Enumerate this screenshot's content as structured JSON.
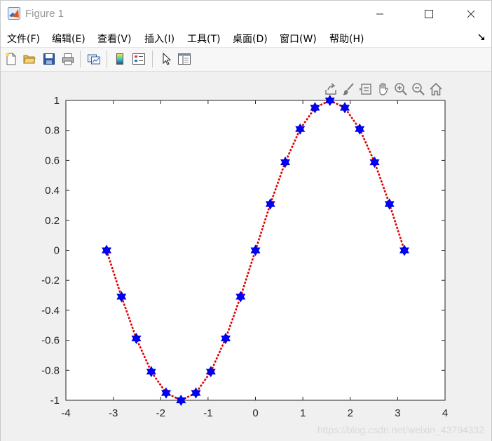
{
  "window": {
    "title": "Figure 1",
    "controls": [
      "minimize",
      "maximize",
      "close"
    ]
  },
  "menubar": {
    "items": [
      "文件(F)",
      "编辑(E)",
      "查看(V)",
      "插入(I)",
      "工具(T)",
      "桌面(D)",
      "窗口(W)",
      "帮助(H)"
    ]
  },
  "toolbar": {
    "buttons": [
      "new-figure",
      "open-file",
      "save",
      "print",
      "link-plot",
      "insert-colorbar",
      "insert-legend",
      "edit-plot",
      "property-inspector"
    ]
  },
  "axes_toolbar": {
    "buttons": [
      "export-icon",
      "brush-icon",
      "data-tips-icon",
      "pan-icon",
      "zoom-in-icon",
      "zoom-out-icon",
      "home-icon"
    ]
  },
  "chart_data": {
    "type": "line",
    "xlim": [
      -4,
      4
    ],
    "ylim": [
      -1,
      1
    ],
    "xticks": [
      "-4",
      "-3",
      "-2",
      "-1",
      "0",
      "1",
      "2",
      "3",
      "4"
    ],
    "yticks": [
      "1",
      "0.8",
      "0.6",
      "0.4",
      "0.2",
      "0",
      "-0.2",
      "-0.4",
      "-0.6",
      "-0.8",
      "-1"
    ],
    "grid": false,
    "series": [
      {
        "line_color": "#e00000",
        "line_style": "dotted",
        "marker": "hexagram",
        "marker_color": "#0000ff",
        "x": [
          -3.1416,
          -2.8274,
          -2.5133,
          -2.1991,
          -1.885,
          -1.5708,
          -1.2566,
          -0.9425,
          -0.6283,
          -0.3142,
          0,
          0.3142,
          0.6283,
          0.9425,
          1.2566,
          1.5708,
          1.885,
          2.1991,
          2.5133,
          2.8274,
          3.1416
        ],
        "y": [
          0,
          -0.309,
          -0.5878,
          -0.809,
          -0.9511,
          -1,
          -0.9511,
          -0.809,
          -0.5878,
          -0.309,
          0,
          0.309,
          0.5878,
          0.809,
          0.9511,
          1,
          0.9511,
          0.809,
          0.5878,
          0.309,
          0
        ]
      }
    ]
  },
  "watermark": "https://blog.csdn.net/weixin_43794332"
}
